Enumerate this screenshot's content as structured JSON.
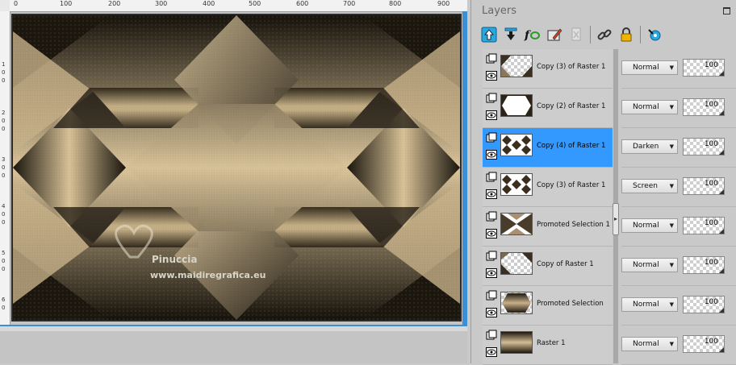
{
  "canvas": {
    "ruler_top": [
      "0",
      "100",
      "200",
      "300",
      "400",
      "500",
      "600",
      "700",
      "800",
      "900"
    ],
    "ruler_left": [
      "1",
      "0",
      "0",
      "2",
      "0",
      "0",
      "3",
      "0",
      "0",
      "4",
      "0",
      "0",
      "5",
      "0",
      "0",
      "6",
      "0"
    ],
    "watermark_name": "Pinuccia",
    "watermark_url": "www.maidiregrafica.eu",
    "palette": {
      "dark": "#141008",
      "mid": "#6b5c45",
      "light": "#d9c49a",
      "tan": "#b9a47e"
    }
  },
  "layers_panel": {
    "title": "Layers",
    "toolbar": [
      {
        "name": "move-layer-up-icon"
      },
      {
        "name": "move-layer-down-icon"
      },
      {
        "name": "fx-layer-styles-icon"
      },
      {
        "name": "edit-selection-icon"
      },
      {
        "name": "delete-layer-icon"
      },
      {
        "name": "link-layers-icon"
      },
      {
        "name": "lock-layer-icon"
      },
      {
        "name": "refresh-layer-icon"
      }
    ],
    "layers": [
      {
        "name": "Copy (3) of Raster 1",
        "blend": "Normal",
        "opacity": "100",
        "selected": false,
        "thumb": "corner"
      },
      {
        "name": "Copy (2) of Raster 1",
        "blend": "Normal",
        "opacity": "100",
        "selected": false,
        "thumb": "hexagon"
      },
      {
        "name": "Copy (4) of Raster 1",
        "blend": "Darken",
        "opacity": "100",
        "selected": true,
        "thumb": "diamonds"
      },
      {
        "name": "Copy (3) of Raster 1",
        "blend": "Screen",
        "opacity": "100",
        "selected": false,
        "thumb": "diamonds"
      },
      {
        "name": "Promoted Selection 1",
        "blend": "Normal",
        "opacity": "100",
        "selected": false,
        "thumb": "xshape"
      },
      {
        "name": "Copy of Raster 1",
        "blend": "Normal",
        "opacity": "100",
        "selected": false,
        "thumb": "triangle"
      },
      {
        "name": "Promoted Selection",
        "blend": "Normal",
        "opacity": "100",
        "selected": false,
        "thumb": "hexdark"
      },
      {
        "name": "Raster 1",
        "blend": "Normal",
        "opacity": "100",
        "selected": false,
        "thumb": "gradient"
      }
    ]
  }
}
